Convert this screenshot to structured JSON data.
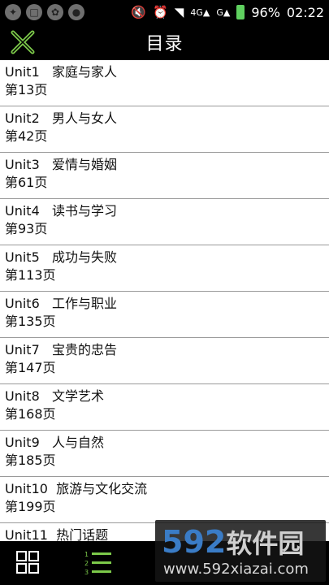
{
  "status": {
    "battery": "96%",
    "time": "02:22",
    "net": "4G",
    "net2": "G"
  },
  "header": {
    "title": "目录"
  },
  "items": [
    {
      "title": "Unit1   家庭与家人",
      "page": "第13页"
    },
    {
      "title": "Unit2   男人与女人",
      "page": "第42页"
    },
    {
      "title": "Unit3   爱情与婚姻",
      "page": "第61页"
    },
    {
      "title": "Unit4   读书与学习",
      "page": "第93页"
    },
    {
      "title": "Unit5   成功与失败",
      "page": "第113页"
    },
    {
      "title": "Unit6   工作与职业",
      "page": "第135页"
    },
    {
      "title": "Unit7   宝贵的忠告",
      "page": "第147页"
    },
    {
      "title": "Unit8   文学艺术",
      "page": "第168页"
    },
    {
      "title": "Unit9   人与自然",
      "page": "第185页"
    },
    {
      "title": "Unit10  旅游与文化交流",
      "page": "第199页"
    },
    {
      "title": "Unit11  热门话题",
      "page": ""
    }
  ],
  "watermark": {
    "brand_num": "592",
    "brand_cn": "软件园",
    "url": "www.592xiazai.com"
  },
  "colors": {
    "accent": "#7cc94a",
    "divider": "#9a9a9a"
  }
}
